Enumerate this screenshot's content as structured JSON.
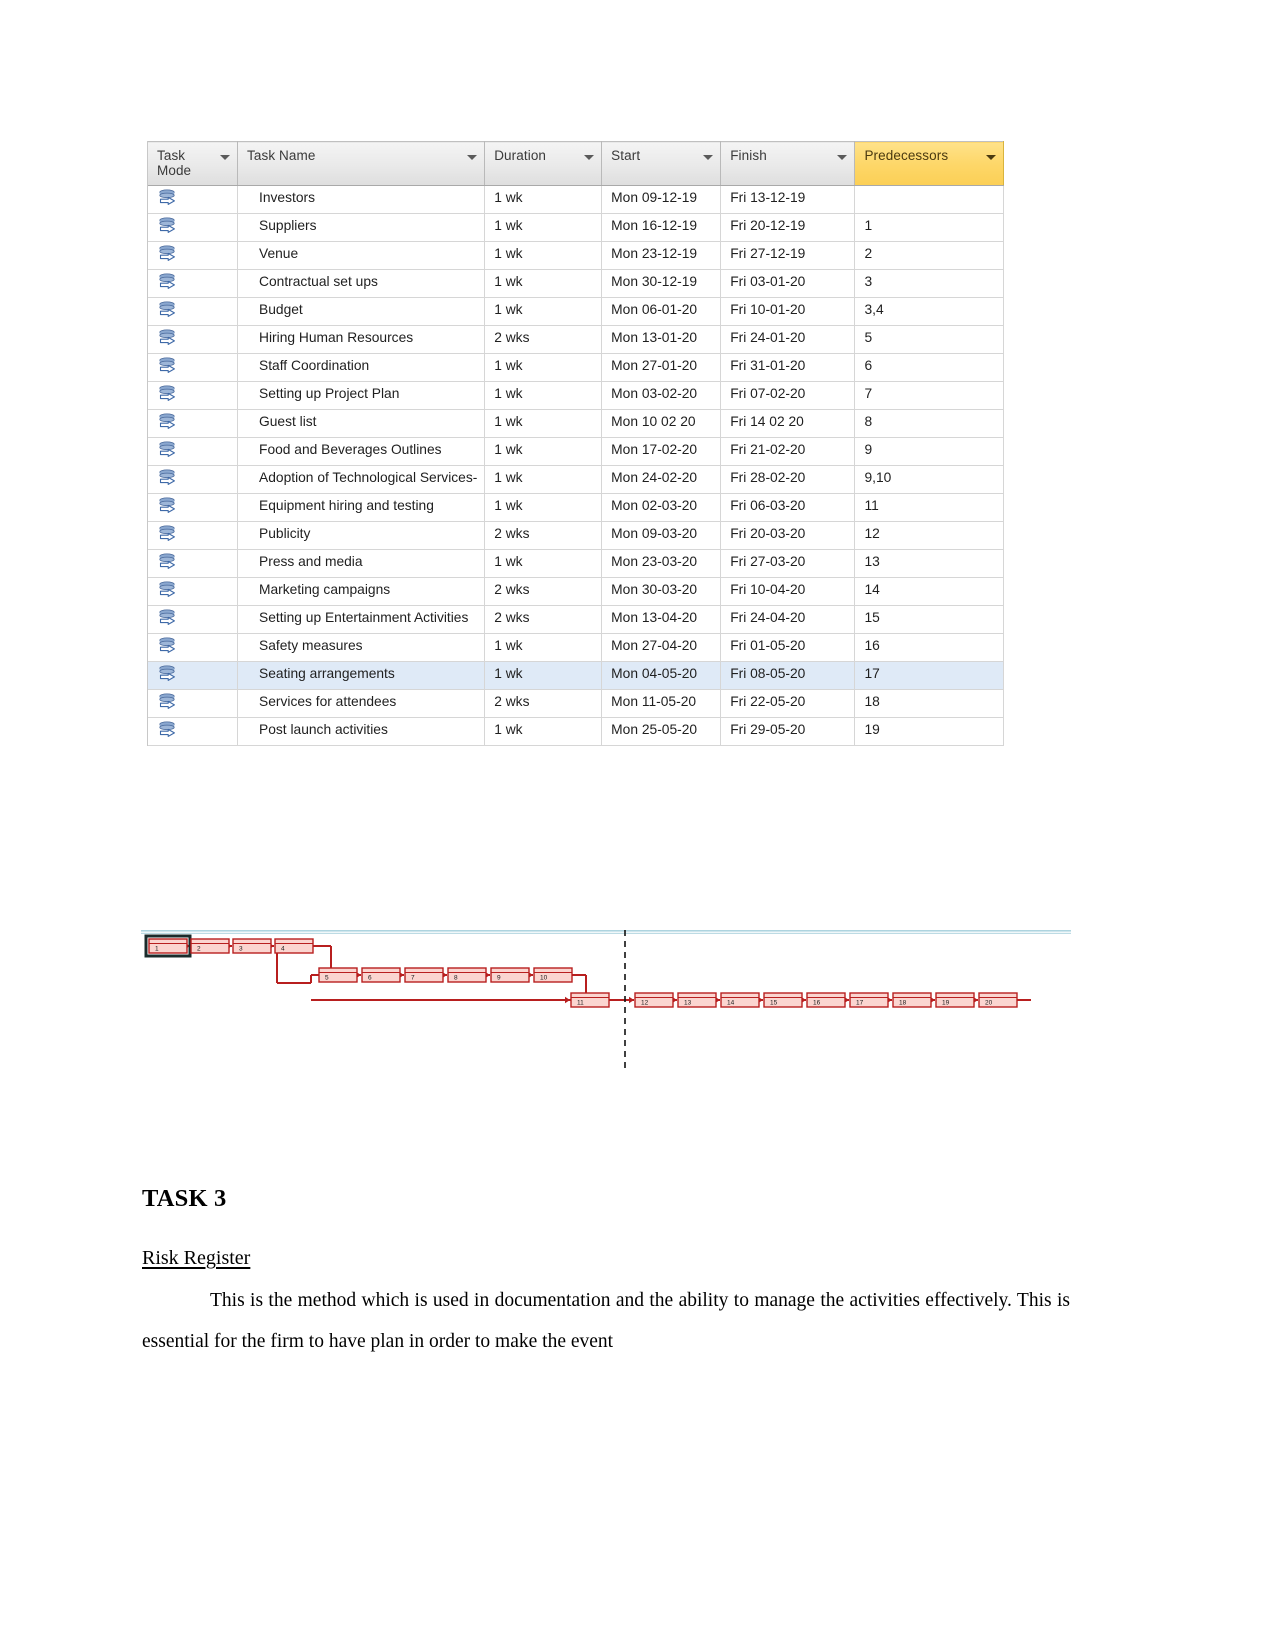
{
  "project_table": {
    "columns": [
      {
        "key": "task_mode",
        "label": "Task\nMode",
        "icon": "filter-arrow-icon",
        "highlighted": false
      },
      {
        "key": "task_name",
        "label": "Task Name",
        "icon": "filter-arrow-icon",
        "highlighted": false
      },
      {
        "key": "duration",
        "label": "Duration",
        "icon": "filter-arrow-icon",
        "highlighted": false
      },
      {
        "key": "start",
        "label": "Start",
        "icon": "filter-arrow-icon",
        "highlighted": false
      },
      {
        "key": "finish",
        "label": "Finish",
        "icon": "filter-arrow-icon",
        "highlighted": false
      },
      {
        "key": "predecessors",
        "label": "Predecessors",
        "icon": "filter-arrow-icon",
        "highlighted": true
      }
    ],
    "header_colors": {
      "predecessors_accent": "#fdd769",
      "default_header": "#e9e9e9",
      "selection": "#dfeaf7"
    },
    "rows": [
      {
        "mode_icon": "auto-schedule-icon",
        "name": "Investors",
        "duration": "1 wk",
        "start": "Mon 09-12-19",
        "finish": "Fri 13-12-19",
        "predecessors": "",
        "selected": false
      },
      {
        "mode_icon": "auto-schedule-icon",
        "name": "Suppliers",
        "duration": "1 wk",
        "start": "Mon 16-12-19",
        "finish": "Fri 20-12-19",
        "predecessors": "1",
        "selected": false
      },
      {
        "mode_icon": "auto-schedule-icon",
        "name": "Venue",
        "duration": "1 wk",
        "start": "Mon 23-12-19",
        "finish": "Fri 27-12-19",
        "predecessors": "2",
        "selected": false
      },
      {
        "mode_icon": "auto-schedule-icon",
        "name": "Contractual set ups",
        "duration": "1 wk",
        "start": "Mon 30-12-19",
        "finish": "Fri 03-01-20",
        "predecessors": "3",
        "selected": false
      },
      {
        "mode_icon": "auto-schedule-icon",
        "name": "Budget",
        "duration": "1 wk",
        "start": "Mon 06-01-20",
        "finish": "Fri 10-01-20",
        "predecessors": "3,4",
        "selected": false
      },
      {
        "mode_icon": "auto-schedule-icon",
        "name": "Hiring Human Resources",
        "duration": "2 wks",
        "start": "Mon 13-01-20",
        "finish": "Fri 24-01-20",
        "predecessors": "5",
        "selected": false
      },
      {
        "mode_icon": "auto-schedule-icon",
        "name": "Staff Coordination",
        "duration": "1 wk",
        "start": "Mon 27-01-20",
        "finish": "Fri 31-01-20",
        "predecessors": "6",
        "selected": false
      },
      {
        "mode_icon": "auto-schedule-icon",
        "name": "Setting up Project Plan",
        "duration": "1 wk",
        "start": "Mon 03-02-20",
        "finish": "Fri 07-02-20",
        "predecessors": "7",
        "selected": false
      },
      {
        "mode_icon": "auto-schedule-icon",
        "name": "Guest list",
        "duration": "1 wk",
        "start": "Mon 10 02 20",
        "finish": "Fri 14 02 20",
        "predecessors": "8",
        "selected": false
      },
      {
        "mode_icon": "auto-schedule-icon",
        "name": "Food and Beverages Outlines",
        "duration": "1 wk",
        "start": "Mon 17-02-20",
        "finish": "Fri 21-02-20",
        "predecessors": "9",
        "selected": false
      },
      {
        "mode_icon": "auto-schedule-icon",
        "name": "Adoption of Technological Services-",
        "duration": "1 wk",
        "start": "Mon 24-02-20",
        "finish": "Fri 28-02-20",
        "predecessors": "9,10",
        "selected": false
      },
      {
        "mode_icon": "auto-schedule-icon",
        "name": "Equipment hiring and testing",
        "duration": "1 wk",
        "start": "Mon 02-03-20",
        "finish": "Fri 06-03-20",
        "predecessors": "11",
        "selected": false
      },
      {
        "mode_icon": "auto-schedule-icon",
        "name": "Publicity",
        "duration": "2 wks",
        "start": "Mon 09-03-20",
        "finish": "Fri 20-03-20",
        "predecessors": "12",
        "selected": false
      },
      {
        "mode_icon": "auto-schedule-icon",
        "name": "Press and media",
        "duration": "1 wk",
        "start": "Mon 23-03-20",
        "finish": "Fri 27-03-20",
        "predecessors": "13",
        "selected": false
      },
      {
        "mode_icon": "auto-schedule-icon",
        "name": "Marketing campaigns",
        "duration": "2 wks",
        "start": "Mon 30-03-20",
        "finish": "Fri 10-04-20",
        "predecessors": "14",
        "selected": false
      },
      {
        "mode_icon": "auto-schedule-icon",
        "name": "Setting up Entertainment Activities",
        "duration": "2 wks",
        "start": "Mon 13-04-20",
        "finish": "Fri 24-04-20",
        "predecessors": "15",
        "selected": false
      },
      {
        "mode_icon": "auto-schedule-icon",
        "name": "Safety measures",
        "duration": "1 wk",
        "start": "Mon 27-04-20",
        "finish": "Fri 01-05-20",
        "predecessors": "16",
        "selected": false
      },
      {
        "mode_icon": "auto-schedule-icon",
        "name": "Seating arrangements",
        "duration": "1 wk",
        "start": "Mon 04-05-20",
        "finish": "Fri 08-05-20",
        "predecessors": "17",
        "selected": true
      },
      {
        "mode_icon": "auto-schedule-icon",
        "name": "Services for attendees",
        "duration": "2 wks",
        "start": "Mon 11-05-20",
        "finish": "Fri 22-05-20",
        "predecessors": "18",
        "selected": false
      },
      {
        "mode_icon": "auto-schedule-icon",
        "name": "Post launch activities",
        "duration": "1 wk",
        "start": "Mon 25-05-20",
        "finish": "Fri 29-05-20",
        "predecessors": "19",
        "selected": false
      }
    ]
  },
  "network_diagram": {
    "node_labels": [
      "1",
      "2",
      "3",
      "4",
      "5",
      "6",
      "7",
      "8",
      "9",
      "10",
      "11",
      "12",
      "13",
      "14",
      "15",
      "16",
      "17",
      "18",
      "19",
      "20"
    ],
    "selected_node": "1",
    "colors": {
      "node_fill": "#fbd5d0",
      "node_border": "#b81f1f",
      "link": "#b81f1f",
      "selection_border": "#1a2b2b"
    },
    "page_break_marker": "dashed-vertical-line"
  },
  "document": {
    "task_heading": "TASK 3",
    "sub_heading": "Risk Register",
    "paragraph": "This is the method which is used in documentation and the ability to manage the activities effectively. This is essential for the firm to have plan in order to make the event"
  }
}
